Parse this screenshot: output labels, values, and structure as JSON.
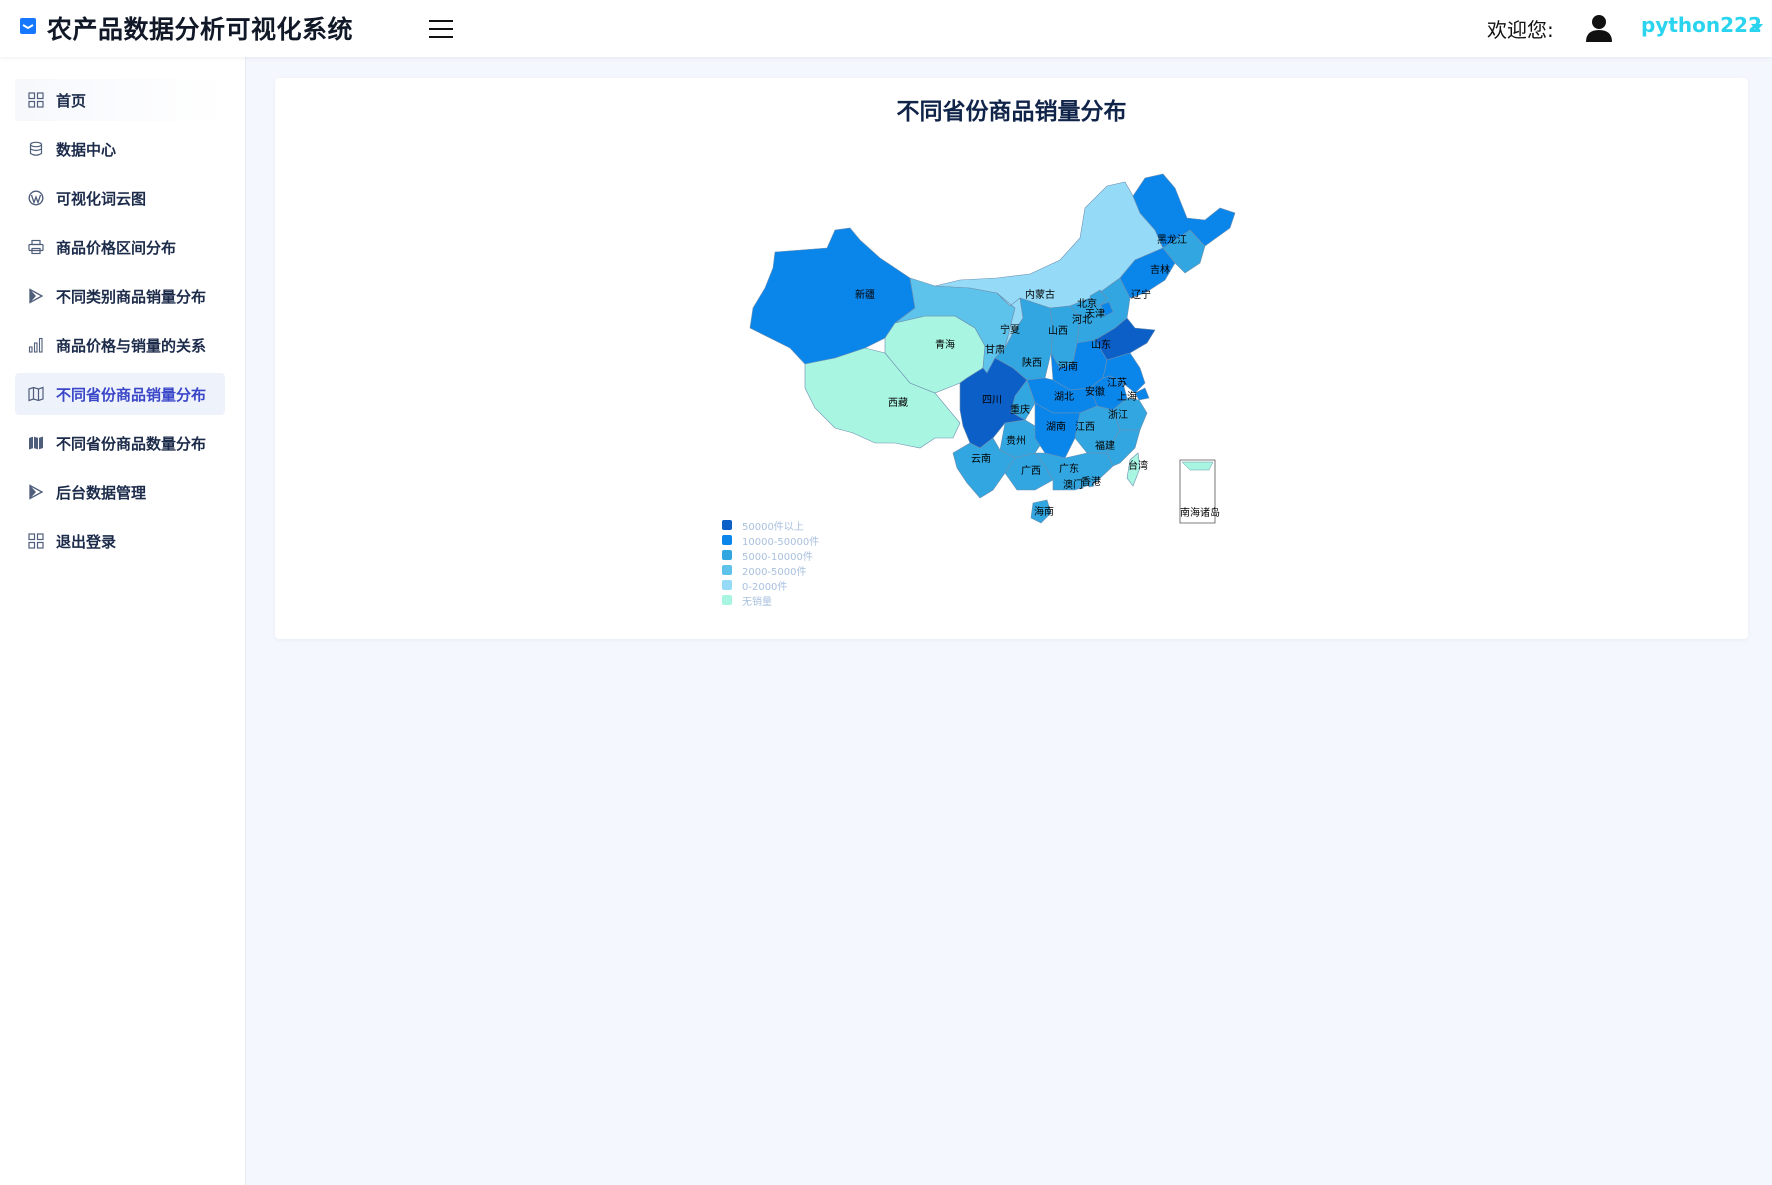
{
  "header": {
    "app_title": "农产品数据分析可视化系统",
    "welcome": "欢迎您:",
    "username": "python222"
  },
  "sidebar": {
    "items": [
      {
        "label": "首页",
        "icon": "grid-icon"
      },
      {
        "label": "数据中心",
        "icon": "database-icon"
      },
      {
        "label": "可视化词云图",
        "icon": "wordpress-icon"
      },
      {
        "label": "商品价格区间分布",
        "icon": "printer-icon"
      },
      {
        "label": "不同类别商品销量分布",
        "icon": "play-icon"
      },
      {
        "label": "商品价格与销量的关系",
        "icon": "bar-chart-icon"
      },
      {
        "label": "不同省份商品销量分布",
        "icon": "map-icon"
      },
      {
        "label": "不同省份商品数量分布",
        "icon": "map-filled-icon"
      },
      {
        "label": "后台数据管理",
        "icon": "play-icon"
      },
      {
        "label": "退出登录",
        "icon": "grid-icon"
      }
    ],
    "active_index": 6
  },
  "chart_data": {
    "type": "map",
    "title": "不同省份商品销量分布",
    "legend": [
      {
        "label": "50000件以上",
        "color": "#0b5fc7"
      },
      {
        "label": "10000-50000件",
        "color": "#0a86eb"
      },
      {
        "label": "5000-10000件",
        "color": "#32a6e0"
      },
      {
        "label": "2000-5000件",
        "color": "#5ec3ea"
      },
      {
        "label": "0-2000件",
        "color": "#95dbf8"
      },
      {
        "label": "无销量",
        "color": "#a8f5e2"
      }
    ],
    "legend_placement": "bottom-left",
    "regions": [
      {
        "name": "新疆",
        "category": "10000-50000件"
      },
      {
        "name": "西藏",
        "category": "无销量"
      },
      {
        "name": "青海",
        "category": "无销量"
      },
      {
        "name": "甘肃",
        "category": "2000-5000件"
      },
      {
        "name": "内蒙古",
        "category": "0-2000件"
      },
      {
        "name": "宁夏",
        "category": "0-2000件"
      },
      {
        "name": "陕西",
        "category": "5000-10000件"
      },
      {
        "name": "山西",
        "category": "5000-10000件"
      },
      {
        "name": "河北",
        "category": "5000-10000件"
      },
      {
        "name": "北京",
        "category": "5000-10000件"
      },
      {
        "name": "天津",
        "category": "10000-50000件"
      },
      {
        "name": "辽宁",
        "category": "10000-50000件"
      },
      {
        "name": "吉林",
        "category": "5000-10000件"
      },
      {
        "name": "黑龙江",
        "category": "10000-50000件"
      },
      {
        "name": "山东",
        "category": "50000件以上"
      },
      {
        "name": "河南",
        "category": "10000-50000件"
      },
      {
        "name": "江苏",
        "category": "10000-50000件"
      },
      {
        "name": "安徽",
        "category": "10000-50000件"
      },
      {
        "name": "上海",
        "category": "10000-50000件"
      },
      {
        "name": "浙江",
        "category": "5000-10000件"
      },
      {
        "name": "湖北",
        "category": "10000-50000件"
      },
      {
        "name": "四川",
        "category": "50000件以上"
      },
      {
        "name": "重庆",
        "category": "5000-10000件"
      },
      {
        "name": "贵州",
        "category": "5000-10000件"
      },
      {
        "name": "湖南",
        "category": "10000-50000件"
      },
      {
        "name": "江西",
        "category": "5000-10000件"
      },
      {
        "name": "福建",
        "category": "5000-10000件"
      },
      {
        "name": "云南",
        "category": "5000-10000件"
      },
      {
        "name": "广西",
        "category": "5000-10000件"
      },
      {
        "name": "广东",
        "category": "5000-10000件"
      },
      {
        "name": "香港",
        "category": "5000-10000件"
      },
      {
        "name": "澳门",
        "category": "5000-10000件"
      },
      {
        "name": "海南",
        "category": "5000-10000件"
      },
      {
        "name": "台湾",
        "category": "无销量"
      },
      {
        "name": "南海诸岛",
        "category": "无销量"
      }
    ]
  }
}
